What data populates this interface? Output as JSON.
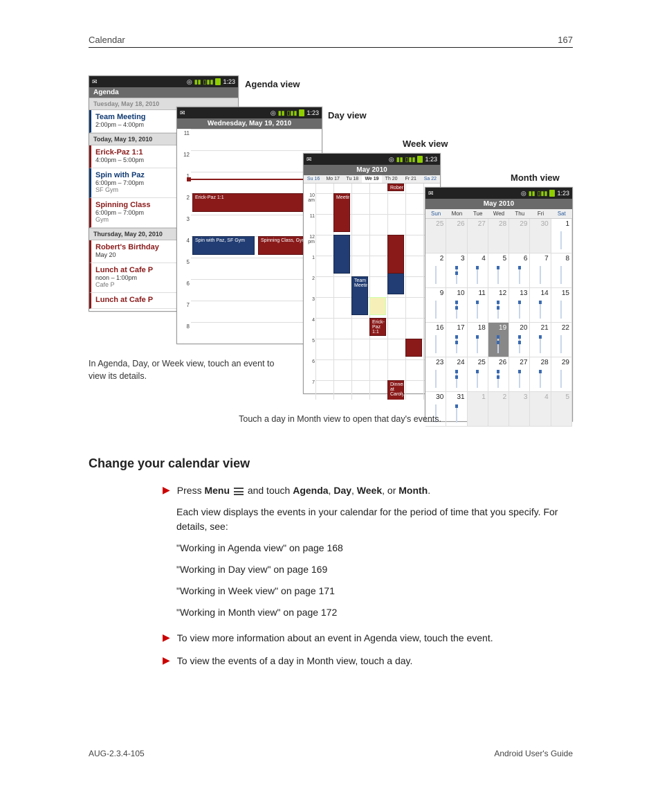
{
  "header": {
    "left": "Calendar",
    "page_number": "167"
  },
  "footer": {
    "left": "AUG-2.3.4-105",
    "right": "Android User's Guide"
  },
  "labels": {
    "agenda": "Agenda view",
    "day": "Day view",
    "week": "Week view",
    "month": "Month view",
    "caption_left": "In Agenda, Day, or Week view, touch an event to view its details.",
    "caption_month": "Touch a day in Month view to open that day's events."
  },
  "status": {
    "time": "1:23"
  },
  "agenda": {
    "title": "Agenda",
    "top_date": "Tuesday, May 18, 2010",
    "groups": [
      {
        "date": "",
        "events": [
          {
            "name": "Team Meeting",
            "time": "2:00pm – 4:00pm",
            "loc": "",
            "color": "blue"
          }
        ]
      },
      {
        "date": "Today, May 19, 2010",
        "events": [
          {
            "name": "Erick-Paz 1:1",
            "time": "4:00pm – 5:00pm",
            "loc": "",
            "color": "red"
          },
          {
            "name": "Spin with Paz",
            "time": "6:00pm – 7:00pm",
            "loc": "SF Gym",
            "color": "blue"
          },
          {
            "name": "Spinning Class",
            "time": "6:00pm – 7:00pm",
            "loc": "Gym",
            "color": "red"
          }
        ]
      },
      {
        "date": "Thursday, May 20, 2010",
        "events": [
          {
            "name": "Robert's Birthday",
            "time": "May 20",
            "loc": "",
            "color": "red"
          },
          {
            "name": "Lunch at Cafe P",
            "time": "noon – 1:00pm",
            "loc": "Cafe P",
            "color": "red"
          },
          {
            "name": "Lunch at Cafe P",
            "time": "",
            "loc": "",
            "color": "red"
          }
        ]
      }
    ]
  },
  "day": {
    "title": "Wednesday, May 19, 2010",
    "hours": [
      "11",
      "12",
      "1",
      "2",
      "3",
      "4",
      "5",
      "6",
      "7",
      "8"
    ],
    "events": [
      {
        "label": "Erick-Paz 1:1",
        "color": "red",
        "h_idx": 4
      },
      {
        "label": "Spin with Paz, SF Gym",
        "color": "blue",
        "h_idx": 6
      },
      {
        "label": "Spinning Class, Gym",
        "color": "red",
        "h_idx": 6
      }
    ]
  },
  "week": {
    "title": "May 2010",
    "days": [
      "Su 16",
      "Mo 17",
      "Tu 18",
      "We 19",
      "Th 20",
      "Fr 21",
      "Sa 22"
    ],
    "allday": {
      "day": 4,
      "label": "Robert"
    },
    "hours": [
      "10 am",
      "11",
      "12 pm",
      "1",
      "2",
      "3",
      "4",
      "5",
      "6",
      "7"
    ],
    "events": [
      {
        "label": "Meeting",
        "color": "red",
        "day": 1,
        "row": 0,
        "rows": 2
      },
      {
        "label": "",
        "color": "blue",
        "day": 1,
        "row": 2,
        "rows": 2
      },
      {
        "label": "Team Meeting",
        "color": "blue",
        "day": 2,
        "row": 4,
        "rows": 2
      },
      {
        "label": "Erick-Paz 1:1",
        "color": "red",
        "day": 3,
        "row": 6,
        "rows": 1
      },
      {
        "label": "",
        "color": "yellow",
        "day": 3,
        "row": 5,
        "rows": 1
      },
      {
        "label": "",
        "color": "blue",
        "day": 4,
        "row": 3,
        "rows": 2
      },
      {
        "label": "",
        "color": "red",
        "day": 4,
        "row": 2,
        "rows": 2
      },
      {
        "label": "",
        "color": "red",
        "day": 5,
        "row": 7,
        "rows": 1
      },
      {
        "label": "Dinner at Caroly",
        "color": "red",
        "day": 4,
        "row": 9,
        "rows": 2
      }
    ]
  },
  "month": {
    "title": "May 2010",
    "daynames": [
      "Sun",
      "Mon",
      "Tue",
      "Wed",
      "Thu",
      "Fri",
      "Sat"
    ],
    "cells": [
      {
        "n": "25",
        "out": true
      },
      {
        "n": "26",
        "out": true
      },
      {
        "n": "27",
        "out": true
      },
      {
        "n": "28",
        "out": true
      },
      {
        "n": "29",
        "out": true
      },
      {
        "n": "30",
        "out": true
      },
      {
        "n": "1",
        "dots": 0
      },
      {
        "n": "2",
        "dots": 0
      },
      {
        "n": "3",
        "dots": 2
      },
      {
        "n": "4",
        "dots": 1
      },
      {
        "n": "5",
        "dots": 1
      },
      {
        "n": "6",
        "dots": 1
      },
      {
        "n": "7",
        "dots": 0
      },
      {
        "n": "8",
        "dots": 0
      },
      {
        "n": "9",
        "dots": 0
      },
      {
        "n": "10",
        "dots": 2
      },
      {
        "n": "11",
        "dots": 1
      },
      {
        "n": "12",
        "dots": 2
      },
      {
        "n": "13",
        "dots": 1
      },
      {
        "n": "14",
        "dots": 1
      },
      {
        "n": "15",
        "dots": 0
      },
      {
        "n": "16",
        "dots": 0
      },
      {
        "n": "17",
        "dots": 2
      },
      {
        "n": "18",
        "dots": 1
      },
      {
        "n": "19",
        "today": true,
        "dots": 2
      },
      {
        "n": "20",
        "dots": 2
      },
      {
        "n": "21",
        "dots": 1
      },
      {
        "n": "22",
        "dots": 0
      },
      {
        "n": "23",
        "dots": 0
      },
      {
        "n": "24",
        "dots": 2
      },
      {
        "n": "25",
        "dots": 1
      },
      {
        "n": "26",
        "dots": 2
      },
      {
        "n": "27",
        "dots": 1
      },
      {
        "n": "28",
        "dots": 1
      },
      {
        "n": "29",
        "dots": 0
      },
      {
        "n": "30",
        "dots": 0
      },
      {
        "n": "31",
        "dots": 1
      },
      {
        "n": "1",
        "out": true
      },
      {
        "n": "2",
        "out": true
      },
      {
        "n": "3",
        "out": true
      },
      {
        "n": "4",
        "out": true
      },
      {
        "n": "5",
        "out": true
      }
    ]
  },
  "section": {
    "title": "Change your calendar view",
    "b1_pre": "Press ",
    "b1_menu": "Menu",
    "b1_mid": " and touch ",
    "b1_a": "Agenda",
    "b1_d": "Day",
    "b1_w": "Week",
    "b1_m": "Month",
    "b1_or": ", or ",
    "p1": "Each view displays the events in your calendar for the period of time that you specify. For details, see:",
    "links": [
      "\"Working in Agenda view\" on page 168",
      "\"Working in Day view\" on page 169",
      "\"Working in Week view\" on page 171",
      "\"Working in Month view\" on page 172"
    ],
    "b2": "To view more information about an event in Agenda view, touch the event.",
    "b3": "To view the events of a day in Month view, touch a day."
  }
}
